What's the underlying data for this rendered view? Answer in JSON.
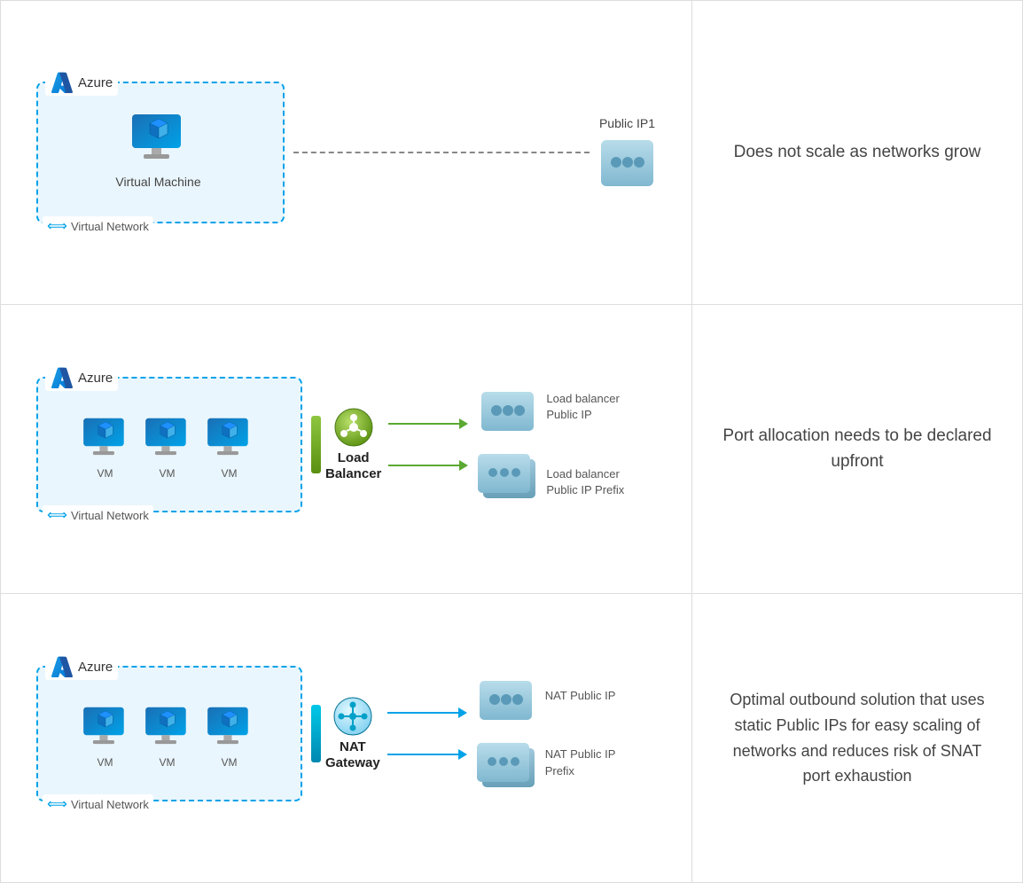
{
  "rows": [
    {
      "id": "row1",
      "azure_label": "Azure",
      "vnet_label": "Virtual Network",
      "vm_label": "Virtual Machine",
      "connection_type": "dashed",
      "public_ip_label": "Public IP1",
      "description": "Does not scale as networks grow",
      "has_single_vm": true,
      "has_multiple_vms": false,
      "middle_label": "",
      "top_server_label": "",
      "bottom_server_label": ""
    },
    {
      "id": "row2",
      "azure_label": "Azure",
      "vnet_label": "Virtual Network",
      "vm_label": "VM",
      "connection_type": "arrow-green",
      "public_ip_label": "Load balancer\nPublic IP",
      "bottom_ip_label": "Load balancer\nPublic IP Prefix",
      "description": "Port allocation needs to be declared upfront",
      "has_single_vm": false,
      "has_multiple_vms": true,
      "middle_label_line1": "Load",
      "middle_label_line2": "Balancer",
      "top_server_label": "Load balancer\nPublic IP",
      "bottom_server_label": "Load balancer\nPublic IP Prefix"
    },
    {
      "id": "row3",
      "azure_label": "Azure",
      "vnet_label": "Virtual Network",
      "vm_label": "VM",
      "connection_type": "arrow-blue",
      "public_ip_label": "NAT Public IP",
      "bottom_ip_label": "NAT Public IP\nPrefix",
      "description": "Optimal outbound solution that uses static Public IPs for easy scaling of networks and reduces risk of SNAT port exhaustion",
      "has_single_vm": false,
      "has_multiple_vms": true,
      "middle_label_line1": "NAT",
      "middle_label_line2": "Gateway",
      "top_server_label": "NAT Public IP",
      "bottom_server_label": "NAT Public IP\nPrefix"
    }
  ]
}
